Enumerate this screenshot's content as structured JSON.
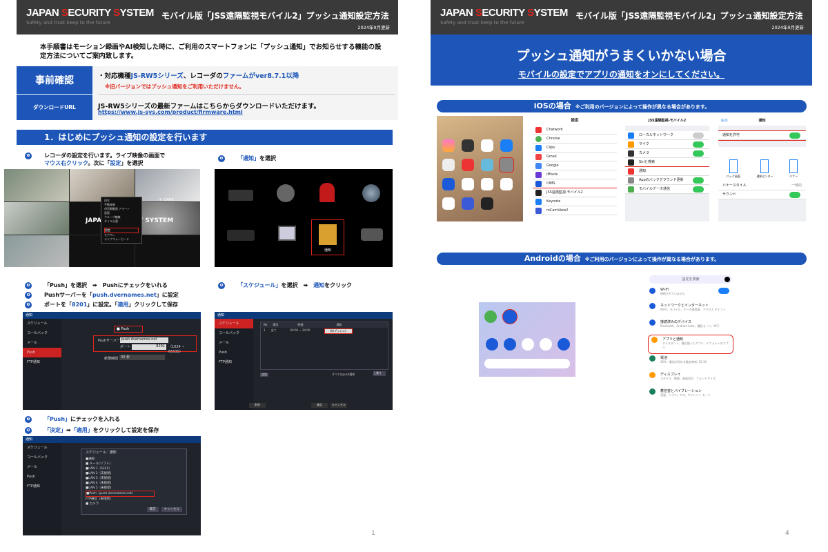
{
  "brand": {
    "name_parts": [
      "JAPAN ",
      "ECURITY ",
      "YSTEM"
    ],
    "tagline": "Safety and trust keep to the future"
  },
  "header": {
    "title": "モバイル版「JSS遠隔監視モバイル2」プッシュ通知設定方法",
    "date": "2024年9月更新"
  },
  "page1": {
    "intro": "本手順書はモーション録画やAI検知した時に、ご利用のスマートフォンに「プッシュ通知」でお知らせする機能の設定方法についてご案内致します。",
    "pre_label": "事前確認",
    "pre_line_parts": [
      "・対応機種",
      "JS-RW5シリーズ",
      "、レコーダの",
      "ファームがver8.7.1以降"
    ],
    "pre_note": "※旧バージョンではプッシュ通知をご利用いただけません。",
    "download_label": "ダウンロードURL",
    "download_text": "JS-RW5シリーズの最新ファームはこちらからダウンロードいただけます。",
    "download_url": "https://www.js-sys.com/product/firmware.html",
    "section_title": "1．はじめにプッシュ通知の設定を行います",
    "step1_a": "レコーダの設定を行います。ライブ映像の画面で",
    "step1_b_parts": [
      "マウス右クリック",
      "。次に「",
      "設定",
      "」を選択"
    ],
    "step2_parts": [
      "「通知」",
      "を選択"
    ],
    "step3_parts": [
      "「Push」を選択　➡　Pushにチェックをいれる"
    ],
    "step4_parts": [
      "Pushサーバーを「",
      "push.dvernames.net",
      "」に設定"
    ],
    "step5_parts": [
      "ポートを「",
      "8201",
      "」に設定。「",
      "適用",
      "」クリックして保存"
    ],
    "step6_parts": [
      "「スケジュール」",
      "を選択　➡　",
      "通知",
      "をクリック"
    ],
    "step7_parts": [
      "「Push」",
      "にチェックを入れる"
    ],
    "step8_parts": [
      "「決定」",
      "➡",
      "「適用」",
      "をクリックして設定を保存"
    ],
    "nums": [
      "❶",
      "❷",
      "❸",
      "❹",
      "❺",
      "❻",
      "❼",
      "❽"
    ],
    "page_number": "1",
    "menu_items": [
      "再生",
      "手動録画",
      "AI活動動画 アラート",
      "画面",
      "クループ編集",
      "タイル分割",
      "",
      "設定",
      "モアクレ",
      "ライブフォーカード"
    ],
    "notify_label": "通知",
    "cam_label": "4. CAM6",
    "nvr_left": [
      "スケジュール",
      "コールバック",
      "メール",
      "Push",
      "FTP通知"
    ],
    "nvr_title": "通知",
    "push_checkbox": "■ Push",
    "push_server_label": "Pushサーバー",
    "push_server_value": "push.dvernames.net",
    "port_label": "ポート",
    "port_value": "8201",
    "port_range": "（1024 ~ 65535）",
    "interval_label": "新規時間",
    "interval_value": "30 秒",
    "sched_header": [
      "No",
      "曜日",
      "時間",
      "通知"
    ],
    "sched_row": [
      "1",
      "全て",
      "00:00 ~ 24:00",
      "有(プッシュ)"
    ],
    "sched_buttons": [
      "追加",
      "削除",
      "確定",
      "キャンセル"
    ],
    "sched_footer": "すべてのpush通知",
    "sched_default": "上書き",
    "dialog_title": "スケジュール：通知",
    "dialog_items": [
      "■通知",
      "■ メール(ソフト)",
      "■LAN 1（SLS1)",
      "■LAN 2（未接続)",
      "■LAN 3（未接続)",
      "■LAN 4（未接続)",
      "■LAN 5（未接続)",
      "■Push（push.dvernames.net)",
      "FTP通信（未接続)",
      "■ カメラ"
    ],
    "dialog_buttons": [
      "確定",
      "キャンセル"
    ]
  },
  "page2": {
    "banner_title": "プッシュ通知がうまくいかない場合",
    "banner_sub": "モバイルの設定でアプリの通知をオンにしてください。",
    "ios_title": "iOSの場合",
    "ios_note": "※ご利用のバージョンによって操作が異なる場合があります。",
    "android_title": "Androidの場合",
    "android_note": "※ご利用のバージョンによって操作が異なる場合があります。",
    "settings_title": "設定",
    "settings_items": [
      "Chatwork",
      "Chrome",
      "Clips",
      "Gmail",
      "Google",
      "iMovie",
      "iUMS",
      "JSS遠隔監視-モバイル2",
      "Keynote",
      "mCamView2"
    ],
    "app_title": "JSS遠隔監視-モバイル2",
    "app_items": [
      "ローカルネットワーク",
      "マイク",
      "カメラ",
      "Siriと検索",
      "通知",
      "Appのバックグラウンド更新",
      "モバイルデータ通信"
    ],
    "back_label": "戻る",
    "notif_title": "通知",
    "allow_label": "通知を許可",
    "notif_styles": [
      "ロック画面",
      "通知センター",
      "バナー"
    ],
    "banner_style": "バナースタイル",
    "banner_style_value": "一時的",
    "sound_label": "サウンド",
    "android_search": "設定を検索",
    "android_items": [
      {
        "t": "Wi-Fi",
        "s": "接続されていません"
      },
      {
        "t": "ネットワークとインターネット",
        "s": "Wi-Fi、モバイル、データ使用量、アクセス ポイント"
      },
      {
        "t": "接続済みのデバイス",
        "s": "Bluetooth、Android Auto、運転モード、NFC"
      },
      {
        "t": "アプリと通知",
        "s": "アシスタント、最近使ったアプリ、デフォルトのアプリ"
      },
      {
        "t": "電池",
        "s": "56%・電池が切れる推定時刻: 15:30"
      },
      {
        "t": "ディスプレイ",
        "s": "スタイル、壁紙、画面消灯、フォントサイズ"
      },
      {
        "t": "着信音とバイブレーション",
        "s": "音量、ハプティクス、サイレント モード"
      }
    ],
    "page_number": "4",
    "colors": {
      "accent": "#1d56b8",
      "highlight": "#e0241b",
      "header": "#3a3a3a"
    }
  }
}
